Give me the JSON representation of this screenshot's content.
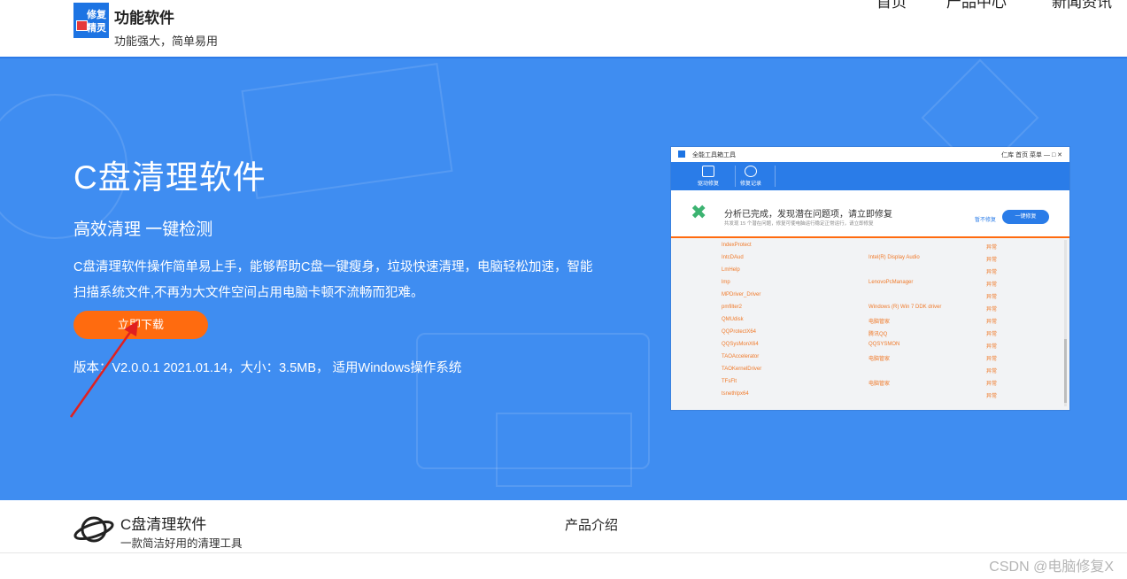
{
  "header": {
    "logo_line1": "修复",
    "logo_line2": "精灵",
    "brand_title": "功能软件",
    "brand_subtitle": "功能强大，简单易用",
    "nav": [
      "首页",
      "产品中心",
      "新闻资讯"
    ]
  },
  "hero": {
    "title": "C盘清理软件",
    "subtitle": "高效清理 一键检测",
    "description": "C盘清理软件操作简单易上手，能够帮助C盘一键瘦身，垃圾快速清理，电脑轻松加速，智能扫描系统文件,不再为大文件空间占用电脑卡顿不流畅而犯难。",
    "download_button": "立即下载",
    "version_info": "版本：V2.0.0.1 2021.01.14，大小：3.5MB， 适用Windows操作系统"
  },
  "app_screenshot": {
    "title": "全能工具箱工具",
    "titlebar_right": "仁库  首页  菜单  —  □  ✕",
    "toolbar": [
      "驱动修复",
      "修复记录"
    ],
    "status_text": "分析已完成，发现潜在问题项，请立即修复",
    "status_detail": "共发现 15 个潜在问题，修复可使电脑运行稳定正常运行，请立即修复",
    "pause_link": "暂不修复",
    "repair_button": "一键修复",
    "rows": [
      {
        "name": "IndexProtect",
        "detail": "",
        "action": "异常"
      },
      {
        "name": "IntcDAud",
        "detail": "Intel(R) Display Audio",
        "action": "异常"
      },
      {
        "name": "LmHelp",
        "detail": "",
        "action": "异常"
      },
      {
        "name": "lmp",
        "detail": "LenovoPcManager",
        "action": "异常"
      },
      {
        "name": "MPDriver_Driver",
        "detail": "",
        "action": "异常"
      },
      {
        "name": "pmfilter2",
        "detail": "Windows (R) Win 7 DDK driver",
        "action": "异常"
      },
      {
        "name": "QMUdisk",
        "detail": "电脑管家",
        "action": "异常"
      },
      {
        "name": "QQProtectX64",
        "detail": "腾讯QQ",
        "action": "异常"
      },
      {
        "name": "QQSysMonX64",
        "detail": "QQSYSMON",
        "action": "异常"
      },
      {
        "name": "TAOAccelerator",
        "detail": "电脑管家",
        "action": "异常"
      },
      {
        "name": "TAOKernelDriver",
        "detail": "",
        "action": "异常"
      },
      {
        "name": "TFsFlt",
        "detail": "电脑管家",
        "action": "异常"
      },
      {
        "name": "tsnethlpx64",
        "detail": "",
        "action": "异常"
      }
    ]
  },
  "footer": {
    "title": "C盘清理软件",
    "subtitle": "一款简洁好用的清理工具",
    "nav": "产品介绍"
  },
  "watermark": "CSDN @电脑修复X",
  "colors": {
    "hero_bg": "#3f8df1",
    "accent_orange": "#ff6b0f",
    "app_blue": "#2a7ce8",
    "arrow_red": "#e02020"
  }
}
